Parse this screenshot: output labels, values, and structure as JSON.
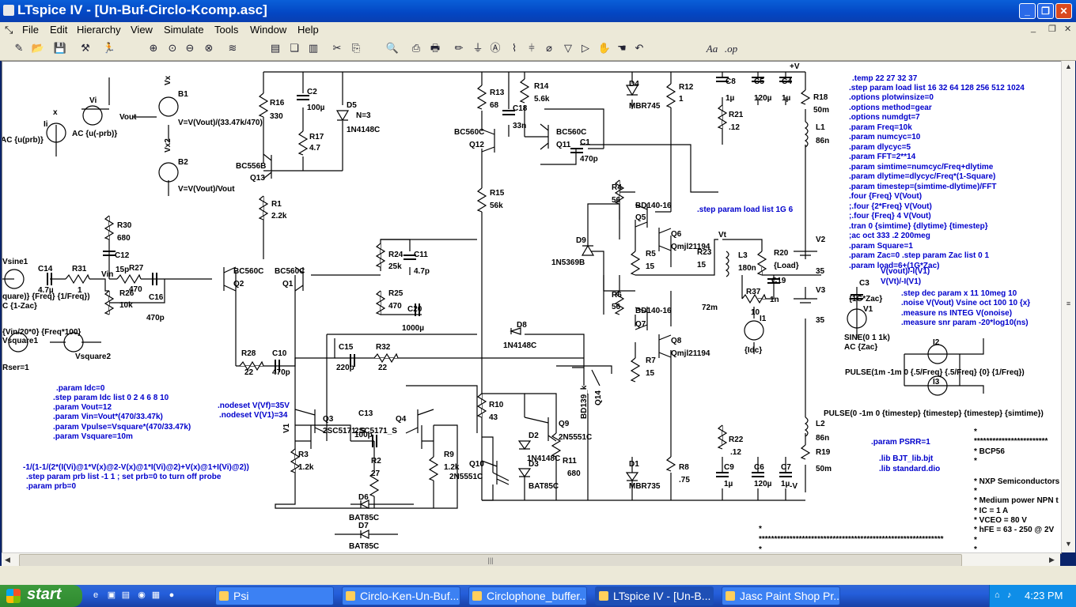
{
  "window": {
    "title": "LTspice IV - [Un-Buf-Circlo-Kcomp.asc]"
  },
  "menu": [
    "File",
    "Edit",
    "Hierarchy",
    "View",
    "Simulate",
    "Tools",
    "Window",
    "Help"
  ],
  "toolbar_right": {
    "aa": "Aa",
    "op": ".op"
  },
  "components": [
    {
      "ref": "Vi",
      "val": "AC {u(-prb)}"
    },
    {
      "ref": "Ii",
      "val": "AC {u(prb)}"
    },
    {
      "ref": "x",
      "val": ""
    },
    {
      "ref": "Vout",
      "val": ""
    },
    {
      "ref": "B1",
      "val": "V=V(Vout)/(33.47k/470)"
    },
    {
      "ref": "Vx",
      "val": ""
    },
    {
      "ref": "Vx2",
      "val": ""
    },
    {
      "ref": "B2",
      "val": "V=V(Vout)/Vout"
    },
    {
      "ref": "R16",
      "val": "330"
    },
    {
      "ref": "C2",
      "val": "100µ"
    },
    {
      "ref": "D5",
      "val": "1N4148C"
    },
    {
      "ref": "N=3",
      "val": ""
    },
    {
      "ref": "R17",
      "val": "4.7"
    },
    {
      "ref": "Q13",
      "val": "BC556B"
    },
    {
      "ref": "R1",
      "val": "2.2k"
    },
    {
      "ref": "R13",
      "val": "68"
    },
    {
      "ref": "R14",
      "val": "5.6k"
    },
    {
      "ref": "C18",
      "val": "33n"
    },
    {
      "ref": "Q12",
      "val": "BC560C"
    },
    {
      "ref": "Q11",
      "val": "BC560C"
    },
    {
      "ref": "C1",
      "val": "470p"
    },
    {
      "ref": "R15",
      "val": "56k"
    },
    {
      "ref": "D4",
      "val": "MBR745"
    },
    {
      "ref": "R12",
      "val": "1"
    },
    {
      "ref": "C8",
      "val": "1µ"
    },
    {
      "ref": "C5",
      "val": "120µ"
    },
    {
      "ref": "C4",
      "val": "1µ"
    },
    {
      "ref": "R21",
      "val": ".12"
    },
    {
      "ref": "R18",
      "val": "50m"
    },
    {
      "ref": "L1",
      "val": "86n"
    },
    {
      "ref": "+V",
      "val": ""
    },
    {
      "ref": "R4",
      "val": "56"
    },
    {
      "ref": "Q5",
      "val": "BD140-16"
    },
    {
      "ref": "Q6",
      "val": "Qmjl21194"
    },
    {
      "ref": "R5",
      "val": "15"
    },
    {
      "ref": "D9",
      "val": "1N5369B"
    },
    {
      "ref": "R6",
      "val": "56"
    },
    {
      "ref": "Q7",
      "val": "BD140-16"
    },
    {
      "ref": "Q8",
      "val": "Qmjl21194"
    },
    {
      "ref": "R7",
      "val": "15"
    },
    {
      "ref": "Q14",
      "val": "BD139_k"
    },
    {
      "ref": "R23",
      "val": "15"
    },
    {
      "ref": "Vt",
      "val": ""
    },
    {
      "ref": "L3",
      "val": "180n"
    },
    {
      "ref": "R20",
      "val": "{Load}"
    },
    {
      "ref": "C19",
      "val": "1n"
    },
    {
      "ref": "R37",
      "val": "10"
    },
    {
      "ref": "I1",
      "val": "{Idc}"
    },
    {
      "ref": "72m",
      "val": ""
    },
    {
      "ref": "V2",
      "val": "35"
    },
    {
      "ref": "V3",
      "val": "35"
    },
    {
      "ref": "Vsine1",
      "val": "C {1-Zac}"
    },
    {
      "ref": "C14",
      "val": "4.7µ"
    },
    {
      "ref": "R31",
      "val": "1"
    },
    {
      "ref": "Vin",
      "val": ""
    },
    {
      "ref": "R30",
      "val": "680"
    },
    {
      "ref": "C12",
      "val": "15p"
    },
    {
      "ref": "R27",
      "val": "470"
    },
    {
      "ref": "R26",
      "val": "10k"
    },
    {
      "ref": "C16",
      "val": "470p"
    },
    {
      "ref": "Q2",
      "val": "BC560C"
    },
    {
      "ref": "Q1",
      "val": "BC560C"
    },
    {
      "ref": "R24",
      "val": "25k"
    },
    {
      "ref": "C11",
      "val": "4.7p"
    },
    {
      "ref": "R25",
      "val": "470"
    },
    {
      "ref": "C20",
      "val": "1000µ"
    },
    {
      "ref": "D8",
      "val": "1N4148C"
    },
    {
      "ref": "R28",
      "val": "22"
    },
    {
      "ref": "C10",
      "val": "470p"
    },
    {
      "ref": "C15",
      "val": "220p"
    },
    {
      "ref": "R32",
      "val": "22"
    },
    {
      "ref": "Q3",
      "val": "2SC5171_S"
    },
    {
      "ref": "C13",
      "val": "100p"
    },
    {
      "ref": "Q4",
      "val": "2SC5171_S"
    },
    {
      "ref": "V1",
      "val": ""
    },
    {
      "ref": "R3",
      "val": "1.2k"
    },
    {
      "ref": "R2",
      "val": "27"
    },
    {
      "ref": "R9",
      "val": "1.2k"
    },
    {
      "ref": "D6",
      "val": "BAT85C"
    },
    {
      "ref": "D7",
      "val": "BAT85C"
    },
    {
      "ref": "R10",
      "val": "43"
    },
    {
      "ref": "Q9",
      "val": "2N5551C"
    },
    {
      "ref": "D2",
      "val": "1N4148C"
    },
    {
      "ref": "D3",
      "val": "BAT85C"
    },
    {
      "ref": "R11",
      "val": "680"
    },
    {
      "ref": "Q10",
      "val": "2N5551C"
    },
    {
      "ref": "D1",
      "val": "MBR735"
    },
    {
      "ref": "R8",
      "val": ".75"
    },
    {
      "ref": "R22",
      "val": ".12"
    },
    {
      "ref": "C9",
      "val": "1µ"
    },
    {
      "ref": "C6",
      "val": "120µ"
    },
    {
      "ref": "C7",
      "val": "1µ"
    },
    {
      "ref": "L2",
      "val": "86n"
    },
    {
      "ref": "R19",
      "val": "50m"
    },
    {
      "ref": "-V",
      "val": ""
    },
    {
      "ref": "C3",
      "val": "{1G*Zac}"
    },
    {
      "ref": "V1",
      "val": "SINE(0 1 1k)"
    },
    {
      "ref": "AC {Zac}",
      "val": ""
    },
    {
      "ref": "I2",
      "val": ""
    },
    {
      "ref": "I3",
      "val": ""
    },
    {
      "ref": "Vsquare1",
      "val": "Rser=1"
    },
    {
      "ref": "Vsquare2",
      "val": ""
    }
  ],
  "directives_right": [
    ".temp 22 27 32 37",
    ".step param load list 16 32 64 128 256 512 1024",
    ".options plotwinsize=0",
    ".options method=gear",
    ".options numdgt=7",
    ".param Freq=10k",
    ".param numcyc=10",
    ".param dlycyc=5",
    ".param FFT=2**14",
    ".param simtime=numcyc/Freq+dlytime",
    ".param dlytime=dlycyc/Freq*(1-Square)",
    ".param timestep=(simtime-dlytime)/FFT",
    ".four {Freq} V(Vout)",
    ";.four {2*Freq} V(Vout)",
    ";.four {Freq} 4 V(Vout)",
    ".tran 0 {simtime} {dlytime} {timestep}",
    ";ac oct 333 .2 200meg",
    ".param Square=1",
    ".param Zac=0  .step param Zac list 0 1",
    ".param load=6+(1G*Zac)"
  ],
  "directives_mid": {
    "step_load_1g": ".step param load list 1G 6",
    "v_expr1": "V(vout)/-I(V1)",
    "v_expr2": "V(Vt)/-I(V1)",
    "noise1": ".step dec param x 11 10meg 10",
    "noise2": ".noise V(Vout) Vsine oct 100 10 {x}",
    "noise3": ".measure ns INTEG V(onoise)",
    "noise4": ".measure snr param -20*log10(ns)",
    "pulse1": "PULSE(1m -1m 0 {.5/Freq} {.5/Freq} {0} {1/Freq})",
    "pulse2": "PULSE(0 -1m 0 {timestep} {timestep} {timestep} {simtime})",
    "psrr": ".param PSRR=1",
    "lib1": ".lib BJT_lib.bjt",
    "lib2": ".lib standard.dio",
    "nodeset1": ".nodeset V(Vf)=35V",
    "nodeset2": ".nodeset V(V1)=34",
    "sources_label": "{Vin/20*0} {Freq*100}",
    "sources_label2": "quare)} {Freq} {1/Freq})"
  },
  "directives_left": [
    ".param Idc=0",
    ".step param Idc list 0 2 4 6 8 10",
    ".param Vout=12",
    ".param Vin=Vout*(470/33.47k)",
    ".param Vpulse=Vsquare*(470/33.47k)",
    ".param Vsquare=10m"
  ],
  "directives_probe": [
    "-1/(1-1/(2*(I(Vi)@1*V(x)@2-V(x)@1*I(Vi)@2)+V(x)@1+I(Vi)@2))",
    ".step param prb list -1 1 ; set prb=0 to turn off probe",
    ".param prb=0"
  ],
  "model_comment": [
    "*",
    "************************",
    "* BCP56",
    "*",
    "* NXP Semiconductors",
    "*",
    "* Medium power NPN t",
    "* IC   = 1 A",
    "* VCEO = 80 V",
    "* hFE  = 63 - 250 @ 2V",
    "*",
    "*"
  ],
  "bottom_comment": [
    "*",
    "************************************************************",
    "*"
  ],
  "taskbar": {
    "start": "start",
    "tasks": [
      "Psi",
      "Circlo-Ken-Un-Buf....",
      "Circlophone_buffer...",
      "LTspice IV - [Un-B...",
      "Jasc Paint Shop Pr..."
    ],
    "clock": "4:23 PM"
  },
  "colors": {
    "wire": "#000000",
    "text": "#000000",
    "directive": "#0000cc",
    "titlebar": "#0a5fd8"
  }
}
